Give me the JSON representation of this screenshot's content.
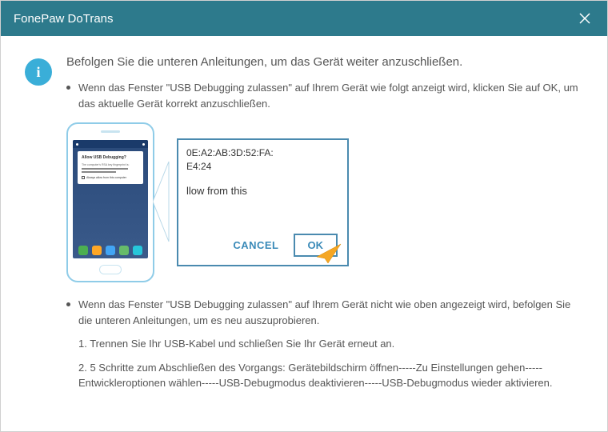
{
  "titlebar": {
    "title": "FonePaw DoTrans"
  },
  "info_icon": "i",
  "heading": "Befolgen Sie die unteren Anleitungen, um das Gerät weiter anzuschließen.",
  "bullet1": "Wenn das Fenster \"USB Debugging zulassen\" auf Ihrem Gerät wie folgt anzeigt wird, klicken Sie auf OK, um das aktuelle Gerät korrekt anzuschließen.",
  "phone_dialog": {
    "title": "Allow USB Debugging?",
    "line1": "The computer's RSA key fingerprint is:",
    "checkbox_label": "Always allow from this computer"
  },
  "zoom": {
    "mac1": "0E:A2:AB:3D:52:FA:",
    "mac2": "E4:24",
    "text": "llow from this",
    "cancel": "CANCEL",
    "ok": "OK"
  },
  "bullet2": "Wenn das Fenster \"USB Debugging zulassen\" auf Ihrem Gerät nicht wie oben angezeigt wird, befolgen Sie die unteren Anleitungen, um es neu auszuprobieren.",
  "step1": "1. Trennen Sie Ihr USB-Kabel und schließen Sie Ihr Gerät erneut an.",
  "step2": "2. 5 Schritte zum Abschließen des Vorgangs: Gerätebildschirm öffnen-----Zu Einstellungen gehen-----Entwickleroptionen wählen-----USB-Debugmodus deaktivieren-----USB-Debugmodus wieder aktivieren."
}
